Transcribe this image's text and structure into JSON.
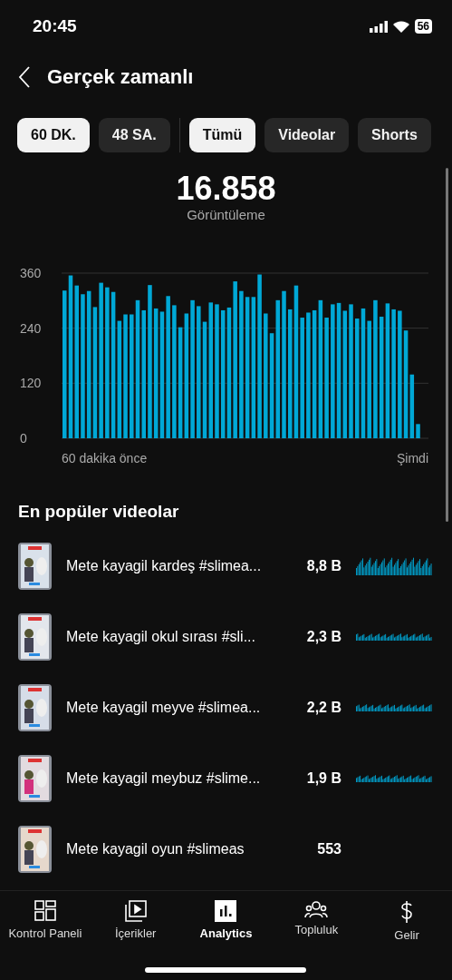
{
  "status_bar": {
    "time": "20:45",
    "battery": "56"
  },
  "header": {
    "title": "Gerçek zamanlı"
  },
  "period_filters": [
    {
      "label": "60 DK.",
      "selected": true
    },
    {
      "label": "48 SA.",
      "selected": false
    }
  ],
  "type_filters": [
    {
      "label": "Tümü",
      "selected": true
    },
    {
      "label": "Videolar",
      "selected": false
    },
    {
      "label": "Shorts",
      "selected": false
    }
  ],
  "total": {
    "value": "16.858",
    "label": "Görüntüleme"
  },
  "chart_axis_labels": [
    "60 dakika önce",
    "Şimdi"
  ],
  "chart_data": {
    "type": "bar",
    "ylim": [
      0,
      360
    ],
    "yticks": [
      0,
      120,
      240,
      360
    ],
    "series": [
      {
        "color": "#00a8d6",
        "values": [
          322,
          355,
          333,
          314,
          321,
          286,
          339,
          329,
          319,
          256,
          270,
          270,
          301,
          279,
          334,
          283,
          276,
          310,
          290,
          242,
          272,
          301,
          288,
          254,
          296,
          292,
          279,
          285,
          342,
          321,
          308,
          308,
          357,
          272,
          229,
          301,
          321,
          281,
          333,
          263,
          274,
          279,
          301,
          263,
          292,
          295,
          278,
          292,
          261,
          283,
          256,
          301,
          265,
          294,
          281,
          278,
          235,
          139,
          31
        ]
      }
    ]
  },
  "top_videos": {
    "title": "En popüler videolar",
    "items": [
      {
        "title": "Mete kayagil kardeş #slimea...",
        "views": "8,8 B"
      },
      {
        "title": "Mete kayagil okul sırası #sli...",
        "views": "2,3 B"
      },
      {
        "title": "Mete kayagil meyve #slimea...",
        "views": "2,2 B"
      },
      {
        "title": "Mete kayagil meybuz #slime...",
        "views": "1,9 B"
      },
      {
        "title": "Mete kayagil oyun #slimeas",
        "views": "553"
      }
    ]
  },
  "bottom_nav": [
    {
      "label": "Kontrol Paneli",
      "selected": false
    },
    {
      "label": "İçerikler",
      "selected": false
    },
    {
      "label": "Analytics",
      "selected": true
    },
    {
      "label": "Topluluk",
      "selected": false
    },
    {
      "label": "Gelir",
      "selected": false
    }
  ]
}
